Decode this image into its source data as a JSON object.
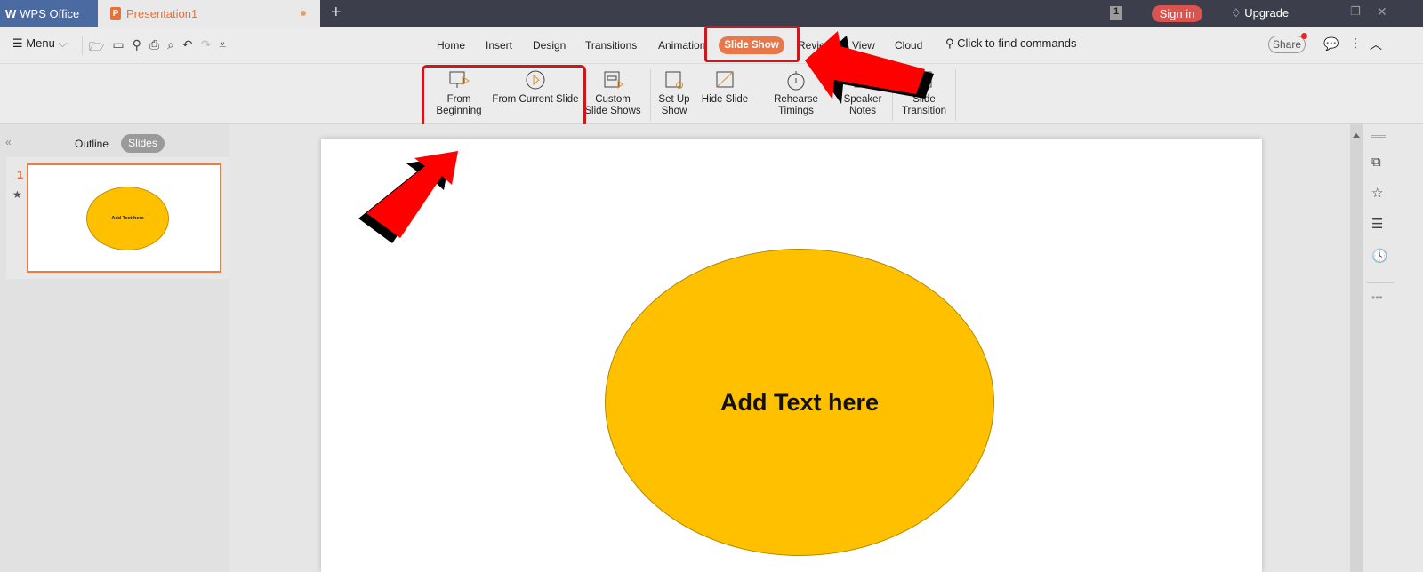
{
  "titlebar": {
    "app_tab": "WPS Office",
    "doc_tab": "Presentation1",
    "page_badge": "1",
    "sign_in": "Sign in",
    "upgrade": "Upgrade"
  },
  "toolbar": {
    "menu": "Menu",
    "tabs": [
      "Home",
      "Insert",
      "Design",
      "Transitions",
      "Animation",
      "Slide Show",
      "Review",
      "View",
      "Cloud"
    ],
    "active_tab": "Slide Show",
    "search": "Click to find commands",
    "share": "Share"
  },
  "ribbon": {
    "from_beginning": [
      "From",
      "Beginning"
    ],
    "from_current": "From Current Slide",
    "custom": [
      "Custom",
      "Slide Shows"
    ],
    "setup": [
      "Set Up",
      "Show"
    ],
    "hide": "Hide Slide",
    "rehearse": "Rehearse Timings",
    "notes": [
      "Speaker",
      "Notes"
    ],
    "transition": [
      "Slide",
      "Transition"
    ]
  },
  "panel": {
    "outline": "Outline",
    "slides": "Slides",
    "slide_number": "1",
    "thumb_text": "Add Text here"
  },
  "slide": {
    "shape_text": "Add Text here",
    "shape_fill": "#ffc000"
  },
  "colors": {
    "accent": "#e8703a",
    "annotation": "#ff0000"
  }
}
